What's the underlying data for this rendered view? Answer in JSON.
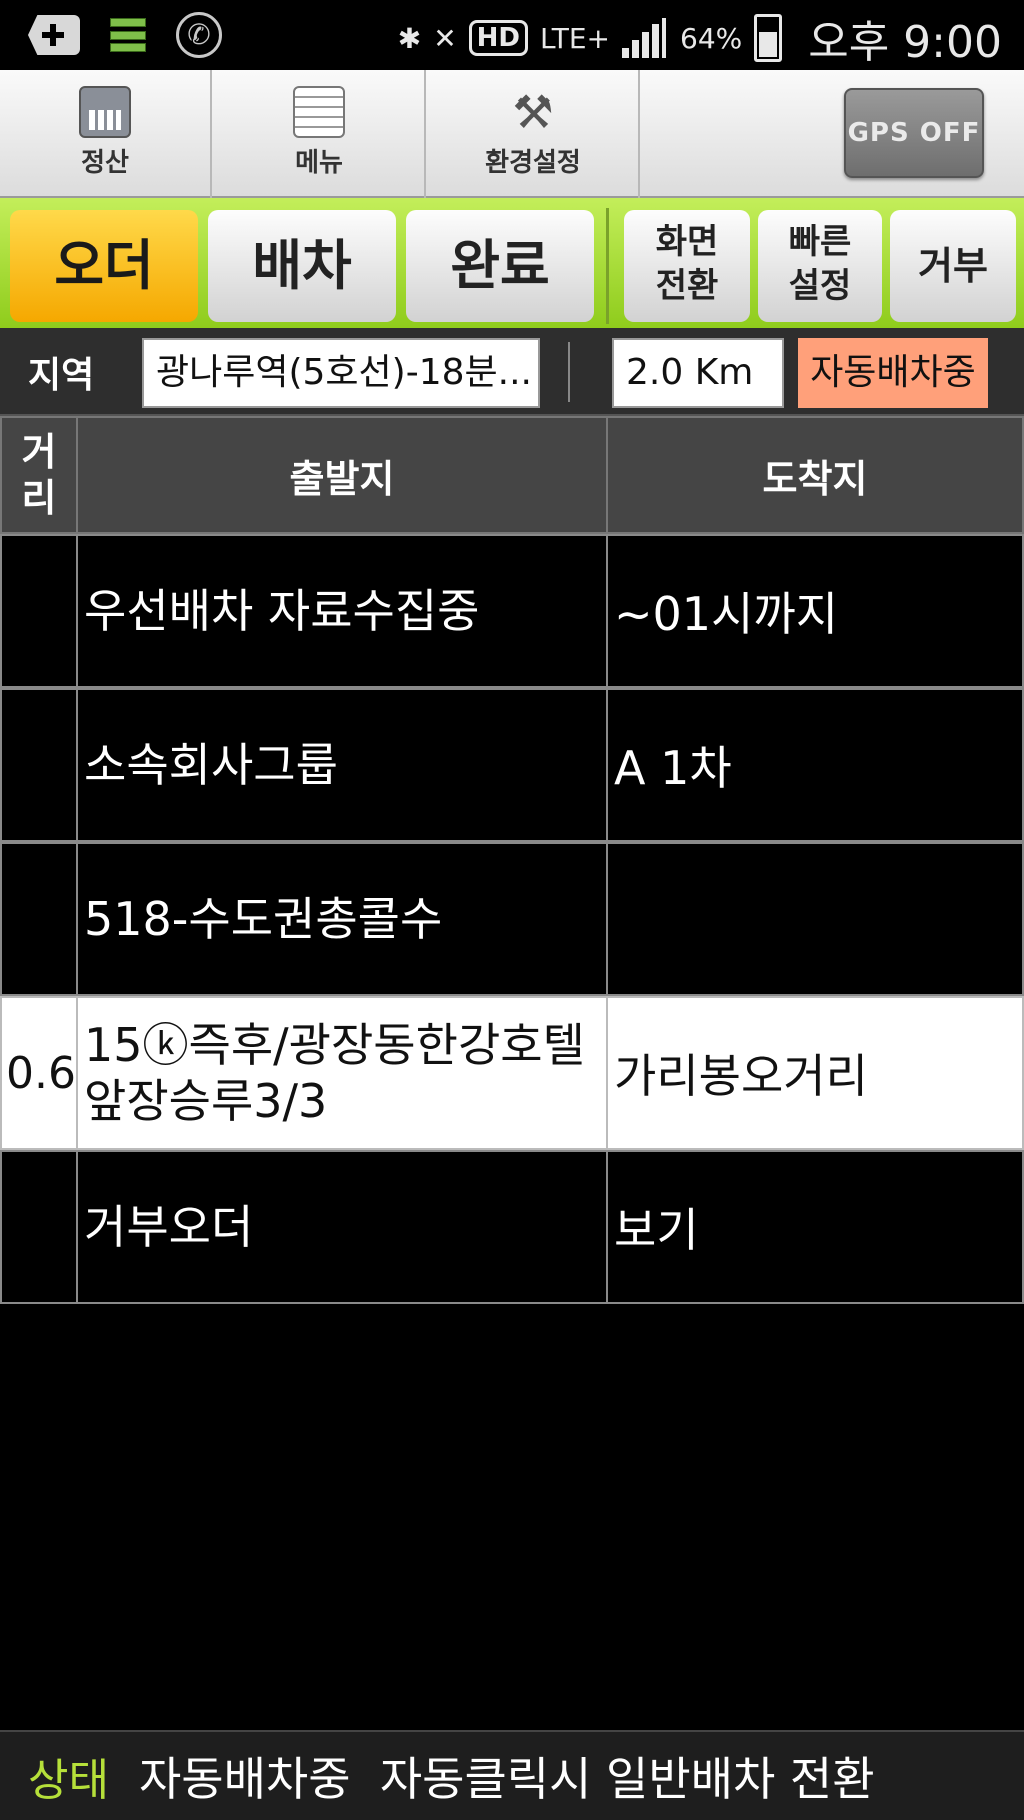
{
  "status_bar": {
    "battery": "64%",
    "time": "오후 9:00",
    "network": "LTE+",
    "hd": "HD"
  },
  "toolbar": {
    "items": [
      {
        "label": "정산",
        "icon": "calculator-icon"
      },
      {
        "label": "메뉴",
        "icon": "menu-list-icon"
      },
      {
        "label": "환경설정",
        "icon": "tools-icon"
      }
    ],
    "gps_label": "GPS OFF"
  },
  "tabs": {
    "order": "오더",
    "dispatch": "배차",
    "complete": "완료",
    "screen_switch": [
      "화면",
      "전환"
    ],
    "quick_settings": [
      "빠른",
      "설정"
    ],
    "reject": "거부"
  },
  "region": {
    "label": "지역",
    "value": "광나루역(5호선)-18분...",
    "distance": "2.0 Km",
    "auto_status": "자동배차중"
  },
  "table": {
    "headers": {
      "distance": [
        "거",
        "리"
      ],
      "departure": "출발지",
      "arrival": "도착지"
    },
    "rows": [
      {
        "distance": "",
        "departure": "우선배차 자료수집중",
        "arrival": "~01시까지",
        "style": "dark"
      },
      {
        "distance": "",
        "departure": "소속회사그룹",
        "arrival": "A 1차",
        "style": "dark"
      },
      {
        "distance": "",
        "departure": "518-수도권총콜수",
        "arrival": "",
        "style": "dark"
      },
      {
        "distance": "0.6",
        "departure": "15ⓚ즉후/광장동한강호텔앞장승루3/3",
        "arrival": "가리봉오거리",
        "style": "light"
      },
      {
        "distance": "",
        "departure": "거부오더",
        "arrival": "보기",
        "style": "dark"
      }
    ]
  },
  "bottom_status": {
    "label": "상태",
    "message": "자동배차중  자동클릭시 일반배차 전환"
  },
  "colors": {
    "tab_bar_green": "#a6dc32",
    "active_tab": "#f5b800",
    "auto_badge": "#ffa07a",
    "status_label": "#b6e03a"
  }
}
